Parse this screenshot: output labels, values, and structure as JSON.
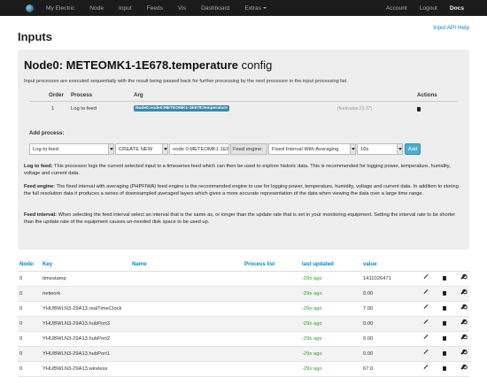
{
  "nav": {
    "items": [
      "My Electric",
      "Node",
      "Input",
      "Feeds",
      "Vis",
      "Dashboard",
      "Extras"
    ],
    "right": [
      "Account",
      "Logout",
      "Docs"
    ]
  },
  "page": {
    "title": "Inputs",
    "help": "Input API Help"
  },
  "config": {
    "title_bold": "Node0: METEOMK1-1E678.temperature",
    "title_rest": " config",
    "description": "Input processes are executed sequentially with the result being passed back for further processing by the next processor in the input processing list.",
    "columns": [
      "Order",
      "Process",
      "Arg",
      "Actions"
    ],
    "rows": [
      {
        "order": "1",
        "process": "Log to feed",
        "arg": "Node0:node0:METEOMK1-1E678:temperature",
        "feedvalue": "(feedvalue:23.37)"
      }
    ],
    "add_label": "Add process:",
    "form": {
      "process": "Log to feed",
      "create": "CREATE NEW",
      "name": "node 0:METEOMK1-1E6",
      "engine_label": "Feed engine:",
      "engine": "Fixed Interval With Averaging",
      "interval": "10s",
      "add": "Add"
    },
    "info": [
      {
        "title": "Log to feed:",
        "text": " This processor logs the current selected input to a timeseries feed which can then be used to explore historic data. This is recommended for logging power, temperature, humidity, voltage and current data."
      },
      {
        "title": "Feed engine:",
        "text": " The fixed interval with averaging (PHPFIWA) feed engine is the recommended engine to use for logging power, temperature, humidity, voltage and current data. In addition to storing the full resolution data it produces a series of downsampled averaged layers which gives a more accurate representation of the data when viewing the data over a large time range."
      },
      {
        "title": "Feed interval:",
        "text": " When selecting the feed interval select an interval that is the same as, or longer than the update rate that is set in your monitoring equipment. Setting the interval rate to be shorter than the update rate of the equipment causes un-needed disk space to be used up."
      }
    ]
  },
  "inputs": {
    "columns": [
      "Node:",
      "Key",
      "Name",
      "Process list",
      "last updated",
      "value"
    ],
    "rows": [
      {
        "node": "0",
        "key": "timestamp",
        "updated": "-29s ago",
        "value": "1411026471"
      },
      {
        "node": "0",
        "key": "network",
        "updated": "-29s ago",
        "value": "0.00"
      },
      {
        "node": "0",
        "key": "YHUBWLN3-29A13.realTimeClock",
        "updated": "-29s ago",
        "value": "7.00"
      },
      {
        "node": "0",
        "key": "YHUBWLN3-29A13.hubPort3",
        "updated": "-29s ago",
        "value": "0.00"
      },
      {
        "node": "0",
        "key": "YHUBWLN3-29A13.hubPort2",
        "updated": "-29s ago",
        "value": "0.00"
      },
      {
        "node": "0",
        "key": "YHUBWLN3-29A13.hubPort1",
        "updated": "-29s ago",
        "value": "0.00"
      },
      {
        "node": "0",
        "key": "YHUBWLN3-29A13.wireless",
        "updated": "-29s ago",
        "value": "67.0"
      }
    ]
  },
  "colors": {
    "navbar": "#1b1b1b",
    "accent": "#0088cc",
    "updated": "#2f9f2f",
    "badge": "#3a87ad",
    "add_button": "#49afcd"
  }
}
